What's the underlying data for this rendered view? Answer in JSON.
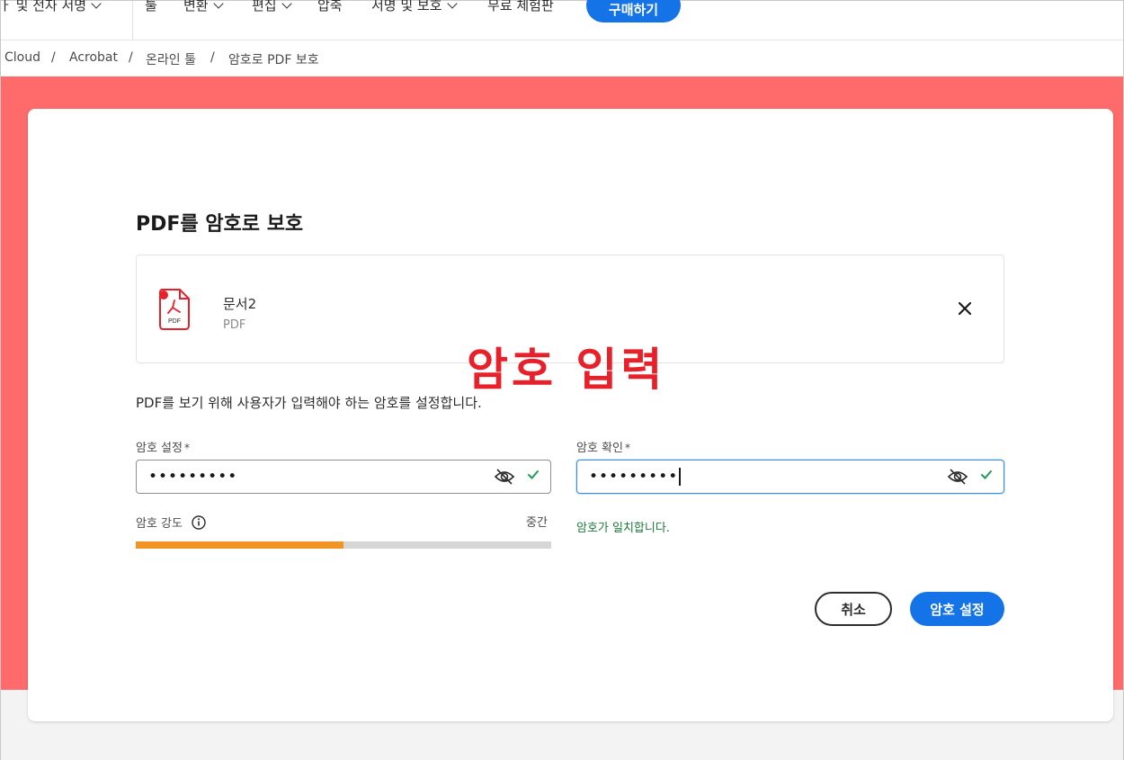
{
  "nav": {
    "items": [
      {
        "label": "ㅏ 및 전자 서명",
        "dropdown": true
      },
      {
        "label": "툴",
        "dropdown": false
      },
      {
        "label": "변환",
        "dropdown": true
      },
      {
        "label": "편집",
        "dropdown": true
      },
      {
        "label": "압축",
        "dropdown": false
      },
      {
        "label": "서명 및 보호",
        "dropdown": true
      },
      {
        "label": "무료 체험판",
        "dropdown": false
      }
    ],
    "buy_label": "구매하기"
  },
  "breadcrumb": [
    "Cloud",
    "Acrobat",
    "온라인 툴",
    "암호로 PDF 보호"
  ],
  "breadcrumb_separator": "/",
  "card": {
    "title": "PDF를 암호로 보호",
    "file": {
      "name": "문서2",
      "type": "PDF",
      "icon_label": "PDF"
    },
    "annotation": "암호 입력",
    "description": "PDF를 보기 위해 사용자가 입력해야 하는 암호를 설정합니다.",
    "password": {
      "label": "암호 설정",
      "required_mark": "*",
      "value": "•••••••••"
    },
    "confirm": {
      "label": "암호 확인",
      "required_mark": "*",
      "value": "•••••••••"
    },
    "strength": {
      "label": "암호 강도",
      "level": "중간",
      "fill": 0.5
    },
    "match_message": "암호가 일치합니다.",
    "cancel_label": "취소",
    "submit_label": "암호 설정"
  },
  "colors": {
    "accent": "#1473e6",
    "band": "#ff6a6a",
    "annotation": "#e8202a",
    "strength": "#f29423",
    "success": "#1c7a3c"
  }
}
